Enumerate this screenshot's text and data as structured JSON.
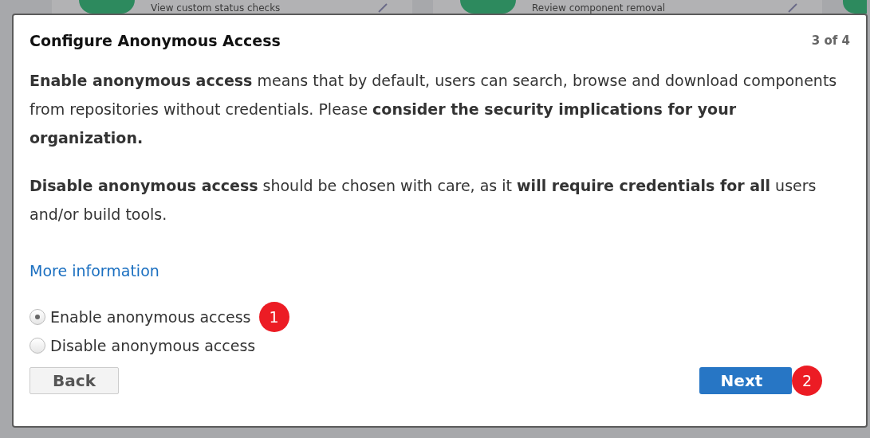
{
  "background_cards": [
    {
      "text": "View custom status checks"
    },
    {
      "text": "Review component removal"
    }
  ],
  "dialog": {
    "title": "Configure Anonymous Access",
    "step": "3 of 4",
    "paragraphs": [
      "**Enable anonymous access** means that by default, users can search, browse and download components from repositories without credentials. Please **consider the security implications for your organization.**",
      "**Disable anonymous access** should be chosen with care, as it **will require credentials for all** users and/or build tools."
    ],
    "link": "More information",
    "options": [
      {
        "label": "Enable anonymous access",
        "selected": true,
        "badge": "1"
      },
      {
        "label": "Disable anonymous access",
        "selected": false
      }
    ],
    "back_button": {
      "label": "Back"
    },
    "next_button": {
      "label": "Next",
      "badge": "2"
    }
  }
}
